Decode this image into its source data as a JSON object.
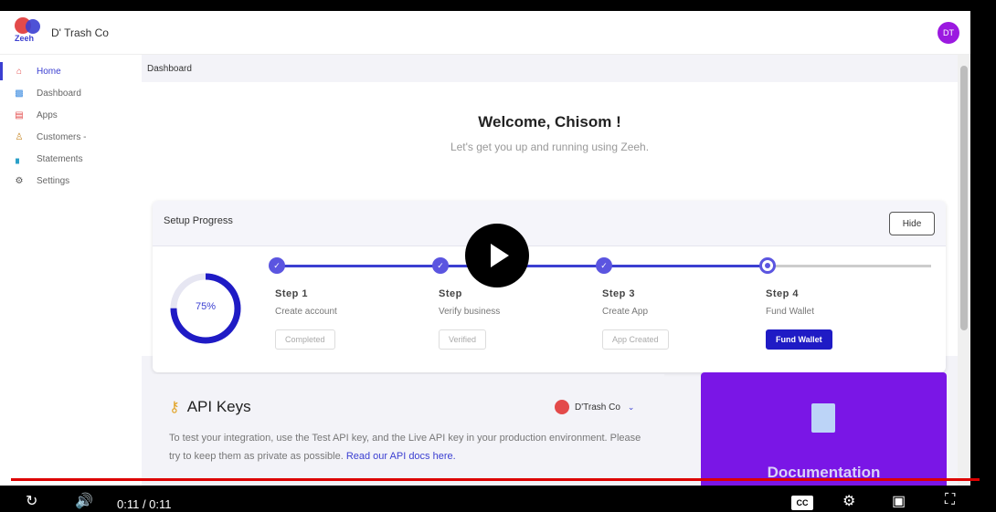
{
  "app": {
    "logo_text": "Zeeh",
    "company": "D' Trash Co",
    "avatar_initials": "DT"
  },
  "sidebar": {
    "items": [
      {
        "label": "Home",
        "icon": "home-icon",
        "active": true
      },
      {
        "label": "Dashboard",
        "icon": "dashboard-icon"
      },
      {
        "label": "Apps",
        "icon": "apps-icon"
      },
      {
        "label": "Customers -",
        "icon": "customers-icon"
      },
      {
        "label": "Statements",
        "icon": "statements-icon"
      },
      {
        "label": "Settings",
        "icon": "gear-icon"
      }
    ]
  },
  "main": {
    "breadcrumb": "Dashboard",
    "welcome_title": "Welcome, Chisom !",
    "welcome_subtitle": "Let's get you up and running using Zeeh.",
    "setup": {
      "title": "Setup Progress",
      "hide_label": "Hide",
      "progress_percent": 75,
      "progress_label": "75%",
      "steps": [
        {
          "num": "Step 1",
          "name": "Create account",
          "button": "Completed",
          "done": true
        },
        {
          "num": "Step",
          "name": "Verify business",
          "button": "Verified",
          "done": true
        },
        {
          "num": "Step 3",
          "name": "Create App",
          "button": "App Created",
          "done": true
        },
        {
          "num": "Step 4",
          "name": "Fund Wallet",
          "button": "Fund Wallet",
          "done": false
        }
      ]
    },
    "api_keys": {
      "title": "API Keys",
      "company_select": "D'Trash Co",
      "description": "To test your integration, use the Test API key, and the Live API key in your production environment. Please try to keep them as private as possible.",
      "link_text": "Read our API docs here."
    },
    "documentation": {
      "title": "Documentation"
    }
  },
  "video": {
    "time": "0:11 / 0:11",
    "cc_label": "CC"
  },
  "colors": {
    "accent": "#3b3fd1",
    "primary_button": "#1f1bc5",
    "doc_card": "#7a16e6",
    "avatar": "#9b19e0",
    "video_progress": "#dd0000"
  }
}
